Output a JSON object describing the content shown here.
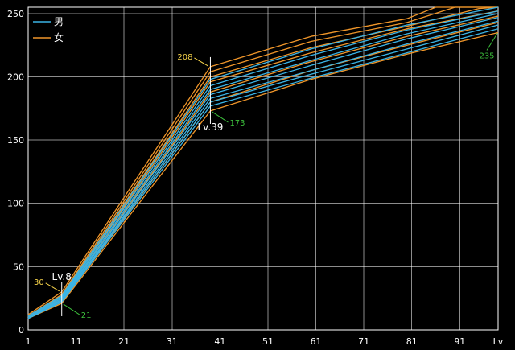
{
  "colors": {
    "background": "#000000",
    "grid": "#ffffff",
    "male": "#3ab4e6",
    "female": "#f0962a",
    "annot_yellow": "#f5d24a",
    "annot_green": "#3cbf3c",
    "marker": "#ffffff"
  },
  "chart_data": {
    "type": "line",
    "title": "",
    "xlabel": "Lv",
    "ylabel": "",
    "xlim": [
      1,
      99
    ],
    "ylim": [
      0,
      255
    ],
    "grid": true,
    "legend": {
      "placement": "top-left",
      "entries": [
        {
          "label": "男",
          "color": "#3ab4e6"
        },
        {
          "label": "女",
          "color": "#f0962a"
        }
      ]
    },
    "x_ticks": [
      "1",
      "11",
      "21",
      "31",
      "41",
      "51",
      "61",
      "71",
      "81",
      "91",
      "Lv"
    ],
    "y_ticks": [
      "0",
      "50",
      "100",
      "150",
      "200",
      "250"
    ],
    "series": [
      {
        "group": "female",
        "color": "#f0962a",
        "points": [
          [
            1,
            12
          ],
          [
            8,
            30
          ],
          [
            39,
            208
          ],
          [
            60,
            232
          ],
          [
            80,
            246
          ],
          [
            86,
            255
          ],
          [
            99,
            255
          ]
        ]
      },
      {
        "group": "female",
        "color": "#f0962a",
        "points": [
          [
            1,
            11
          ],
          [
            8,
            28
          ],
          [
            39,
            204
          ],
          [
            60,
            228
          ],
          [
            80,
            243
          ],
          [
            90,
            255
          ],
          [
            99,
            255
          ]
        ]
      },
      {
        "group": "female",
        "color": "#f0962a",
        "points": [
          [
            1,
            11
          ],
          [
            8,
            27
          ],
          [
            39,
            200
          ],
          [
            60,
            223
          ],
          [
            80,
            240
          ],
          [
            95,
            254
          ],
          [
            99,
            255
          ]
        ]
      },
      {
        "group": "female",
        "color": "#f0962a",
        "points": [
          [
            1,
            10
          ],
          [
            8,
            26
          ],
          [
            39,
            196
          ],
          [
            60,
            219
          ],
          [
            80,
            238
          ],
          [
            99,
            252
          ]
        ]
      },
      {
        "group": "female",
        "color": "#f0962a",
        "points": [
          [
            1,
            10
          ],
          [
            8,
            24
          ],
          [
            39,
            188
          ],
          [
            60,
            212
          ],
          [
            80,
            232
          ],
          [
            99,
            248
          ]
        ]
      },
      {
        "group": "female",
        "color": "#f0962a",
        "points": [
          [
            1,
            9
          ],
          [
            8,
            22
          ],
          [
            39,
            180
          ],
          [
            60,
            205
          ],
          [
            80,
            225
          ],
          [
            99,
            243
          ]
        ]
      },
      {
        "group": "female",
        "color": "#f0962a",
        "points": [
          [
            1,
            9
          ],
          [
            8,
            21
          ],
          [
            39,
            173
          ],
          [
            60,
            198
          ],
          [
            80,
            218
          ],
          [
            99,
            235
          ]
        ]
      },
      {
        "group": "male",
        "color": "#3ab4e6",
        "points": [
          [
            1,
            11
          ],
          [
            8,
            27
          ],
          [
            39,
            198
          ],
          [
            60,
            222
          ],
          [
            80,
            241
          ],
          [
            99,
            255
          ]
        ]
      },
      {
        "group": "male",
        "color": "#3ab4e6",
        "points": [
          [
            1,
            11
          ],
          [
            8,
            26
          ],
          [
            39,
            193
          ],
          [
            60,
            217
          ],
          [
            80,
            237
          ],
          [
            99,
            252
          ]
        ]
      },
      {
        "group": "male",
        "color": "#3ab4e6",
        "points": [
          [
            1,
            10
          ],
          [
            8,
            25
          ],
          [
            39,
            190
          ],
          [
            60,
            213
          ],
          [
            80,
            234
          ],
          [
            99,
            250
          ]
        ]
      },
      {
        "group": "male",
        "color": "#3ab4e6",
        "points": [
          [
            1,
            10
          ],
          [
            8,
            24
          ],
          [
            39,
            186
          ],
          [
            60,
            209
          ],
          [
            80,
            230
          ],
          [
            99,
            247
          ]
        ]
      },
      {
        "group": "male",
        "color": "#3ab4e6",
        "points": [
          [
            1,
            10
          ],
          [
            8,
            23
          ],
          [
            39,
            183
          ],
          [
            60,
            205
          ],
          [
            80,
            226
          ],
          [
            99,
            244
          ]
        ]
      },
      {
        "group": "male",
        "color": "#3ab4e6",
        "points": [
          [
            1,
            9
          ],
          [
            8,
            23
          ],
          [
            39,
            180
          ],
          [
            60,
            202
          ],
          [
            80,
            222
          ],
          [
            99,
            241
          ]
        ]
      },
      {
        "group": "male",
        "color": "#3ab4e6",
        "points": [
          [
            1,
            9
          ],
          [
            8,
            22
          ],
          [
            39,
            177
          ],
          [
            60,
            199
          ],
          [
            80,
            219
          ],
          [
            99,
            238
          ]
        ]
      }
    ],
    "markers": [
      {
        "level": 8,
        "label": "Lv.8",
        "high": 30,
        "low": 21
      },
      {
        "level": 39,
        "label": "Lv.39",
        "high": 208,
        "low": 173
      }
    ],
    "end_annotation": {
      "level": 99,
      "value": 235,
      "label": "235"
    }
  }
}
